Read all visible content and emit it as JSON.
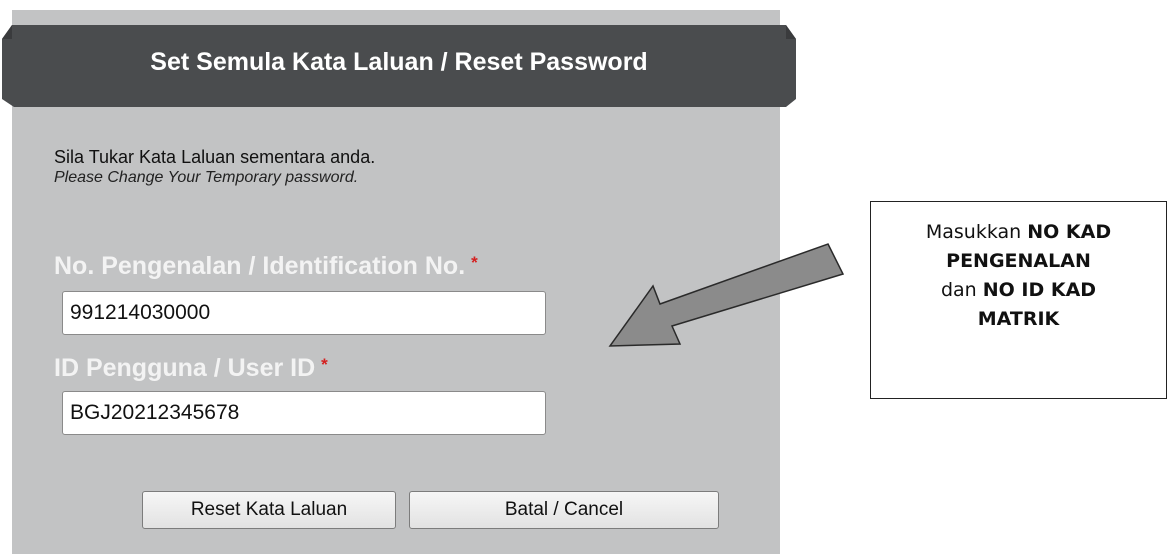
{
  "dialog": {
    "title": "Set Semula Kata Laluan / Reset Password",
    "instruction_ms": "Sila Tukar Kata Laluan sementara anda.",
    "instruction_en": "Please Change Your Temporary password.",
    "fields": [
      {
        "label": "No. Pengenalan / Identification No.",
        "required_marker": "*",
        "value": "991214030000"
      },
      {
        "label": "ID Pengguna / User ID",
        "required_marker": "*",
        "value": "BGJ20212345678"
      }
    ],
    "buttons": {
      "reset_label": "Reset Kata Laluan",
      "cancel_label": "Batal / Cancel"
    }
  },
  "callout": {
    "line1_prefix": "Masukkan ",
    "line1_bold": "NO KAD",
    "line2_bold": "PENGENALAN",
    "line3_prefix": "dan ",
    "line3_bold": "NO ID KAD",
    "line4_bold": "MATRIK"
  },
  "colors": {
    "panel_bg": "#c2c3c4",
    "banner_bg": "#4a4c4e",
    "label_text": "#f3f3f3",
    "required": "#d42020",
    "arrow_fill": "#8b8b8b"
  }
}
